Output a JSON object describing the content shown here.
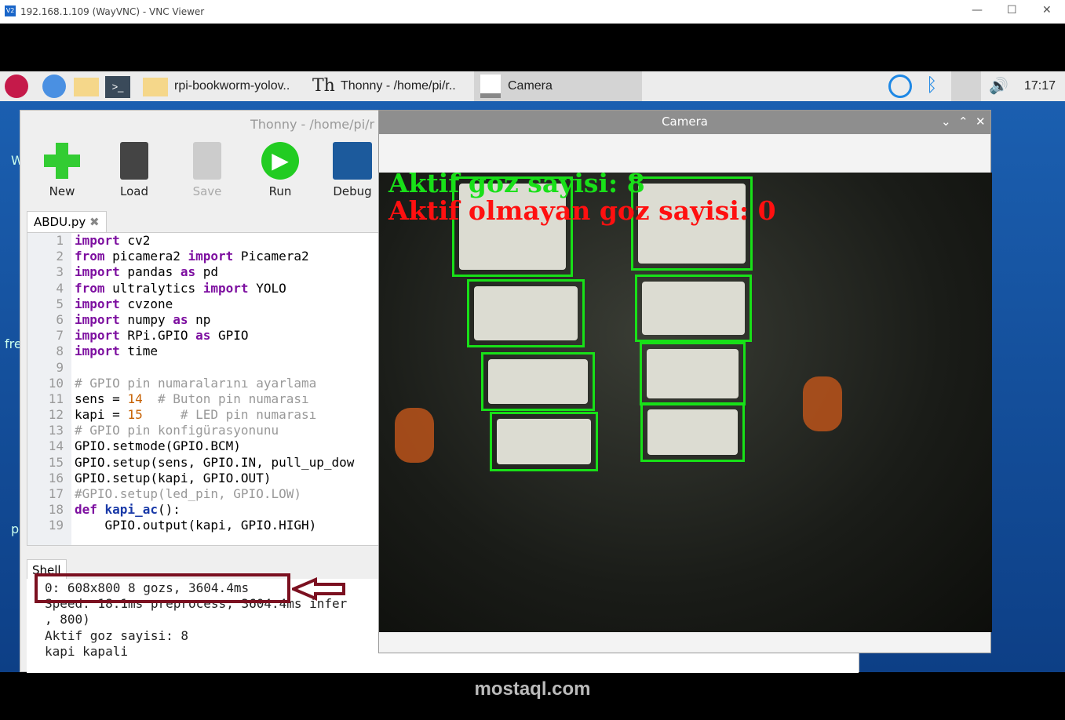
{
  "vnc": {
    "title": "192.168.1.109 (WayVNC) - VNC Viewer",
    "logo": "V2",
    "min": "—",
    "max": "☐",
    "close": "✕"
  },
  "taskbar": {
    "files_task": "rpi-bookworm-yolov..",
    "thonny_task": "Thonny  -  /home/pi/r..",
    "camera_task": "Camera",
    "clock": "17:17"
  },
  "thonny": {
    "title": "Thonny  -  /home/pi/r",
    "toolbar": {
      "new": "New",
      "load": "Load",
      "save": "Save",
      "run": "Run",
      "debug": "Debug"
    },
    "tab": "ABDU.py",
    "tab_close": "✖",
    "shell_tab": "Shell",
    "line_numbers": [
      "1",
      "2",
      "3",
      "4",
      "5",
      "6",
      "7",
      "8",
      "9",
      "10",
      "11",
      "12",
      "13",
      "14",
      "15",
      "16",
      "17",
      "18",
      "19"
    ],
    "shell_lines": [
      "0: 608x800 8 gozs, 3604.4ms",
      "Speed: 18.1ms preprocess, 3604.4ms infer",
      ", 800)",
      "Aktif goz sayisi: 8",
      "kapi kapali"
    ]
  },
  "code": [
    [
      "import",
      " cv2"
    ],
    [
      "from",
      " picamera2 ",
      "import",
      " Picamera2"
    ],
    [
      "import",
      " pandas ",
      "as",
      " pd"
    ],
    [
      "from",
      " ultralytics ",
      "import",
      " YOLO"
    ],
    [
      "import",
      " cvzone"
    ],
    [
      "import",
      " numpy ",
      "as",
      " np"
    ],
    [
      "import",
      " RPi.GPIO ",
      "as",
      " GPIO"
    ],
    [
      "import",
      " time"
    ]
  ],
  "code_rest": {
    "l10": "# GPIO pin numaralarını ayarlama",
    "l11a": "sens = ",
    "l11n": "14",
    "l11c": "  # Buton pin numarası",
    "l12a": "kapi = ",
    "l12n": "15",
    "l12c": "     # LED pin numarası",
    "l13": "# GPIO pin konfigürasyonunu",
    "l14": "GPIO.setmode(GPIO.BCM)",
    "l15": "GPIO.setup(sens, GPIO.IN, pull_up_dow",
    "l16": "GPIO.setup(kapi, GPIO.OUT)",
    "l17": "#GPIO.setup(led_pin, GPIO.LOW)",
    "l18k": "def ",
    "l18f": "kapi_ac",
    "l18r": "():",
    "l19": "    GPIO.output(kapi, GPIO.HIGH)"
  },
  "camera": {
    "title": "Camera",
    "controls": {
      "down": "⌄",
      "up": "⌃",
      "close": "✕"
    },
    "overlay_active": "Aktif goz sayisi: 8",
    "overlay_inactive": "Aktif olmayan goz sayisi: 0",
    "colors": {
      "box": "#18e018",
      "inactive": "#ff1010"
    }
  },
  "desktop": {
    "left_text1": "W",
    "left_text2": "fre",
    "left_text3": "p"
  },
  "watermark": "mostaql.com"
}
